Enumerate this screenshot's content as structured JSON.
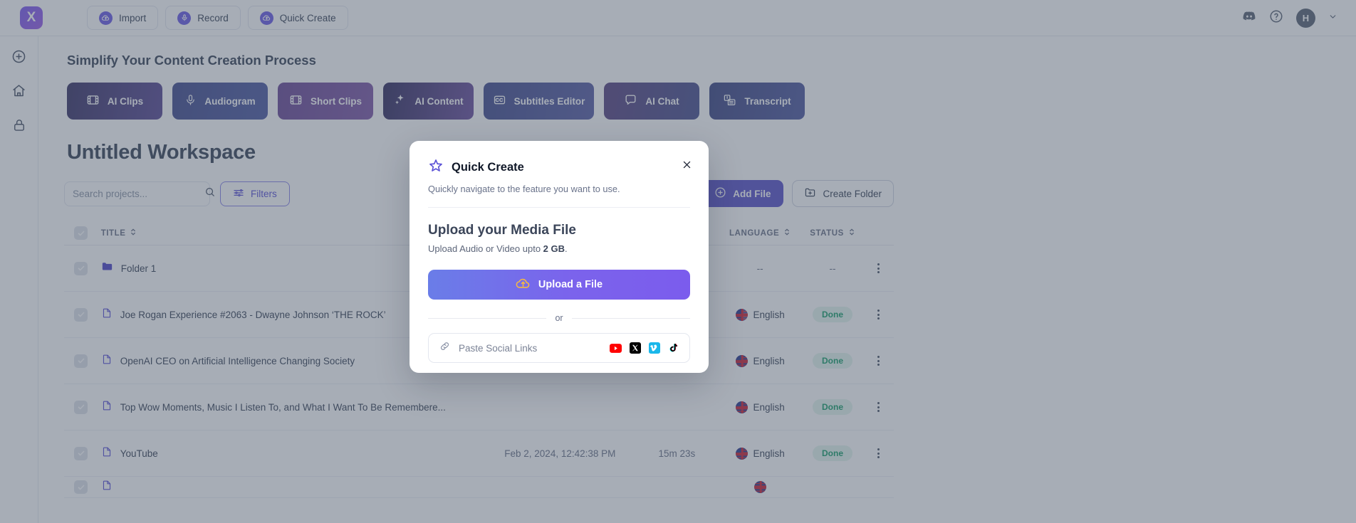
{
  "app": {
    "logo_letter": "X",
    "accent": "#5b53c9",
    "gradient_start": "#6a7de8",
    "gradient_end": "#7b5ced"
  },
  "topbar": {
    "buttons": [
      {
        "label": "Import",
        "icon": "cloud-upload-icon"
      },
      {
        "label": "Record",
        "icon": "microphone-icon"
      },
      {
        "label": "Quick Create",
        "icon": "cloud-upload-icon"
      }
    ],
    "right_icons": [
      {
        "name": "discord-icon"
      },
      {
        "name": "help-circle-icon"
      }
    ],
    "avatar_letter": "H"
  },
  "rail": {
    "items": [
      {
        "name": "add-icon"
      },
      {
        "name": "home-icon"
      },
      {
        "name": "lock-icon"
      }
    ]
  },
  "main": {
    "section_title": "Simplify Your Content Creation Process",
    "features": [
      {
        "label": "AI Clips",
        "icon": "film-icon",
        "from": "#3b3566",
        "to": "#5b4a96"
      },
      {
        "label": "Audiogram",
        "icon": "microphone-icon",
        "from": "#434d8e",
        "to": "#4f5ba3"
      },
      {
        "label": "Short Clips",
        "icon": "film-icon",
        "from": "#6b4a96",
        "to": "#8059a8"
      },
      {
        "label": "AI Content",
        "icon": "sparkle-icon",
        "from": "#342f60",
        "to": "#6a4f9e"
      },
      {
        "label": "Subtitles Editor",
        "icon": "captions-icon",
        "from": "#434d8e",
        "to": "#5a5fa6"
      },
      {
        "label": "AI Chat",
        "icon": "chat-icon",
        "from": "#5a4481",
        "to": "#4a5190"
      },
      {
        "label": "Transcript",
        "icon": "transcript-icon",
        "from": "#3e4783",
        "to": "#515aa0"
      }
    ],
    "workspace_title": "Untitled Workspace",
    "search": {
      "placeholder": "Search projects...",
      "value": "",
      "icon": "search-icon"
    },
    "filters_label": "Filters",
    "add_file_label": "Add File",
    "create_folder_label": "Create Folder",
    "table": {
      "columns": [
        {
          "key": "title",
          "label": "TITLE",
          "sortable": true
        },
        {
          "key": "date",
          "label": "",
          "sortable": false
        },
        {
          "key": "duration",
          "label": "",
          "sortable": false
        },
        {
          "key": "language",
          "label": "LANGUAGE",
          "sortable": true
        },
        {
          "key": "status",
          "label": "STATUS",
          "sortable": true
        }
      ],
      "rows": [
        {
          "title": "Folder 1",
          "icon": "folder-icon",
          "date": "",
          "duration": "",
          "language": "--",
          "status": "--",
          "has_flag": false
        },
        {
          "title": "Joe Rogan Experience #2063 - Dwayne Johnson ‘THE ROCK’",
          "icon": "file-icon",
          "date": "",
          "duration": "",
          "language": "English",
          "status": "Done",
          "has_flag": true
        },
        {
          "title": "OpenAI CEO on Artificial Intelligence Changing Society",
          "icon": "file-icon",
          "date": "",
          "duration": "",
          "language": "English",
          "status": "Done",
          "has_flag": true
        },
        {
          "title": "Top Wow Moments, Music I Listen To, and What I Want To Be Remembere...",
          "icon": "file-icon",
          "date": "",
          "duration": "",
          "language": "English",
          "status": "Done",
          "has_flag": true
        },
        {
          "title": "YouTube",
          "icon": "file-icon",
          "date": "Feb 2, 2024, 12:42:38 PM",
          "duration": "15m 23s",
          "language": "English",
          "status": "Done",
          "has_flag": true
        }
      ]
    }
  },
  "modal": {
    "icon": "star-icon",
    "title": "Quick Create",
    "subtitle": "Quickly navigate to the feature you want to use.",
    "close_icon": "close-icon",
    "upload_heading": "Upload your Media File",
    "upload_sub_prefix": "Upload Audio or Video upto ",
    "upload_sub_bold": "2 GB",
    "upload_sub_suffix": ".",
    "upload_button_label": "Upload a File",
    "upload_button_icon": "cloud-upload-icon",
    "or_label": "or",
    "social_placeholder": "Paste Social Links",
    "link_icon": "link-icon",
    "social_icons": [
      {
        "name": "youtube-icon",
        "color": "#ff0000"
      },
      {
        "name": "x-twitter-icon",
        "color": "#000000"
      },
      {
        "name": "vimeo-icon",
        "color": "#1ab7ea"
      },
      {
        "name": "tiktok-icon",
        "color": "#000000"
      }
    ]
  }
}
